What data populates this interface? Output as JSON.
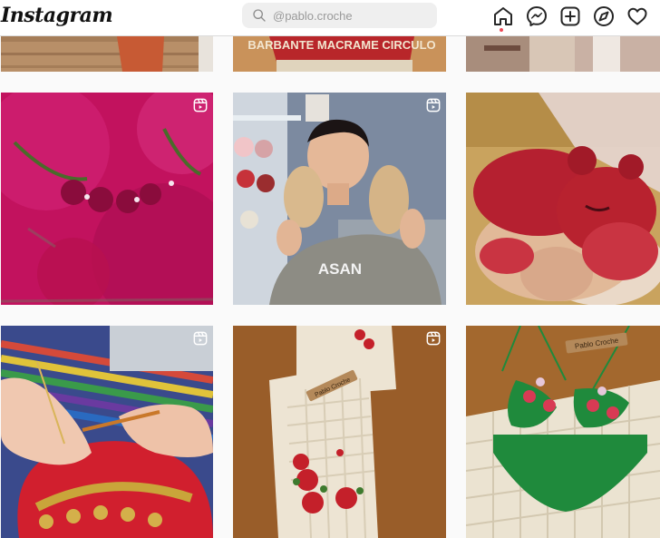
{
  "header": {
    "logo_text": "Instagram",
    "search_placeholder": "@pablo.croche",
    "notification_color": "#ed4956"
  },
  "nav_icons": [
    "home-icon",
    "messenger-icon",
    "new-post-icon",
    "explore-icon",
    "activity-heart-icon"
  ],
  "posts": [
    {
      "id": "r0c0",
      "label": "",
      "subject": "crochet on wooden floor"
    },
    {
      "id": "r0c1",
      "label": "BARBANTE MACRAME CIRCULO",
      "subject": "yarn spool"
    },
    {
      "id": "r0c2",
      "label": "",
      "subject": "person in knit sweater"
    },
    {
      "id": "r1c0",
      "label": "",
      "subject": "pink fuzzy crochet with flowers",
      "reel": true
    },
    {
      "id": "r1c1",
      "label": "ASAN",
      "subject": "man holding yarn skeins",
      "reel": true
    },
    {
      "id": "r1c2",
      "label": "",
      "subject": "red velvet hippo amigurumi"
    },
    {
      "id": "r2c0",
      "label": "",
      "subject": "hands crocheting red piece",
      "reel": true
    },
    {
      "id": "r2c1",
      "label": "Pablo Croche",
      "subject": "cream table runner with roses",
      "reel": true
    },
    {
      "id": "r2c2",
      "label": "Pablo Croche",
      "subject": "green crochet bikini"
    }
  ]
}
